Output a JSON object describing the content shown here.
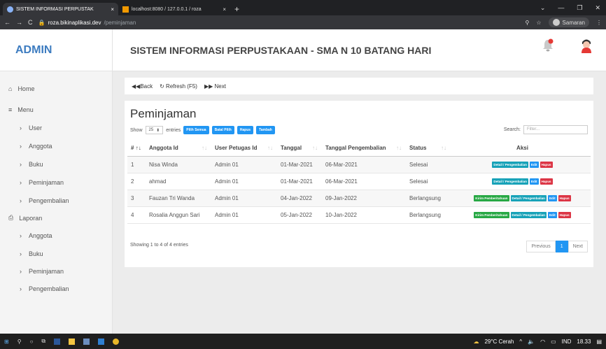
{
  "browser": {
    "tabs": [
      {
        "label": "SISTEM INFORMASI PERPUSTAK",
        "close": "×"
      },
      {
        "label": "localhost:8080 / 127.0.0.1 / roza",
        "close": "×"
      }
    ],
    "new_tab": "+",
    "url_host": "roza.bikinaplikasi.dev",
    "url_path": "/peminjaman",
    "profile_name": "Samaran"
  },
  "app": {
    "brand": "ADMIN",
    "title": "SISTEM INFORMASI PERPUSTAKAAN - SMA N 10 BATANG HARI"
  },
  "sidebar": {
    "home": "Home",
    "menu": "Menu",
    "menu_items": [
      "User",
      "Anggota",
      "Buku",
      "Peminjaman",
      "Pengembalian"
    ],
    "laporan": "Laporan",
    "laporan_items": [
      "Anggota",
      "Buku",
      "Peminjaman",
      "Pengembalian"
    ]
  },
  "toolbar": {
    "back": "Back",
    "refresh": "Refresh (F5)",
    "next": "Next"
  },
  "page": {
    "title": "Peminjaman",
    "show": "Show",
    "entries_value": "25",
    "entries": "entries",
    "btn_pilih_semua": "Pilih Semua",
    "btn_batal_pilih": "Batal Pilih",
    "btn_hapus": "Hapus",
    "btn_tambah": "Tambah",
    "search_label": "Search:",
    "search_placeholder": "Filter...",
    "info": "Showing 1 to 4 of 4 entries",
    "pager_prev": "Previous",
    "pager_current": "1",
    "pager_next": "Next"
  },
  "table": {
    "headers": [
      "#",
      "Anggota Id",
      "User Petugas Id",
      "Tanggal",
      "Tanggal Pengembalian",
      "Status",
      "Aksi"
    ],
    "rows": [
      {
        "no": "1",
        "anggota": "Nisa Winda",
        "petugas": "Admin 01",
        "tanggal": "01-Mar-2021",
        "kembali": "06-Mar-2021",
        "status": "Selesai",
        "kirim": ""
      },
      {
        "no": "2",
        "anggota": "ahmad",
        "petugas": "Admin 01",
        "tanggal": "01-Mar-2021",
        "kembali": "06-Mar-2021",
        "status": "Selesai",
        "kirim": ""
      },
      {
        "no": "3",
        "anggota": "Fauzan Tri Wanda",
        "petugas": "Admin 01",
        "tanggal": "04-Jan-2022",
        "kembali": "09-Jan-2022",
        "status": "Berlangsung",
        "kirim": "Kirim Pemberitahuan"
      },
      {
        "no": "4",
        "anggota": "Rosalia Anggun Sari",
        "petugas": "Admin 01",
        "tanggal": "05-Jan-2022",
        "kembali": "10-Jan-2022",
        "status": "Berlangsung",
        "kirim": "Kirim Pemberitahuan"
      }
    ],
    "btn_detail": "Detail / Pengembalian",
    "btn_edit": "Edit",
    "btn_hapus": "Hapus"
  },
  "taskbar": {
    "weather": "29°C Cerah",
    "lang": "IND",
    "time": "18.33"
  },
  "colors": {
    "brand": "#3d7cc0",
    "primary": "#2196f3",
    "danger": "#dc3545",
    "success": "#27a844",
    "info": "#17a2b8"
  }
}
